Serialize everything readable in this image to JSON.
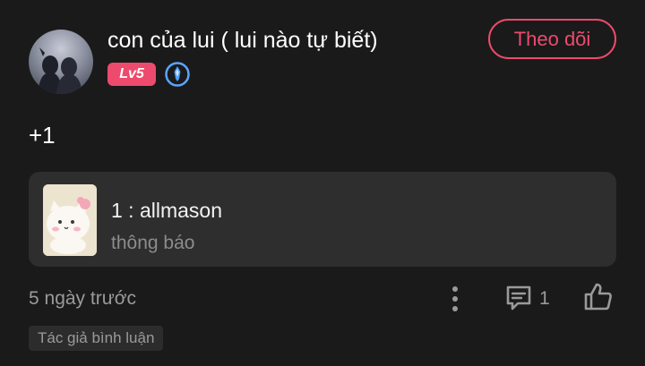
{
  "author": {
    "name": "con của lui ( lui nào tự biết)",
    "level": "Lv5",
    "avatar_icon": "avatar-photo",
    "badge_icon": "verified-badge-icon"
  },
  "follow_label": "Theo dõi",
  "post": {
    "text": "+1"
  },
  "quote": {
    "title": "1 : allmason",
    "subtitle": "thông báo",
    "thumbnail_icon": "cat-sticker"
  },
  "footer": {
    "time": "5 ngày trước",
    "comment_count": "1",
    "tag": "Tác giả bình luận"
  },
  "colors": {
    "accent": "#ee4a6d",
    "background": "#1a1a1a",
    "card": "#2e2e2e",
    "muted_text": "#9a9a9a"
  }
}
